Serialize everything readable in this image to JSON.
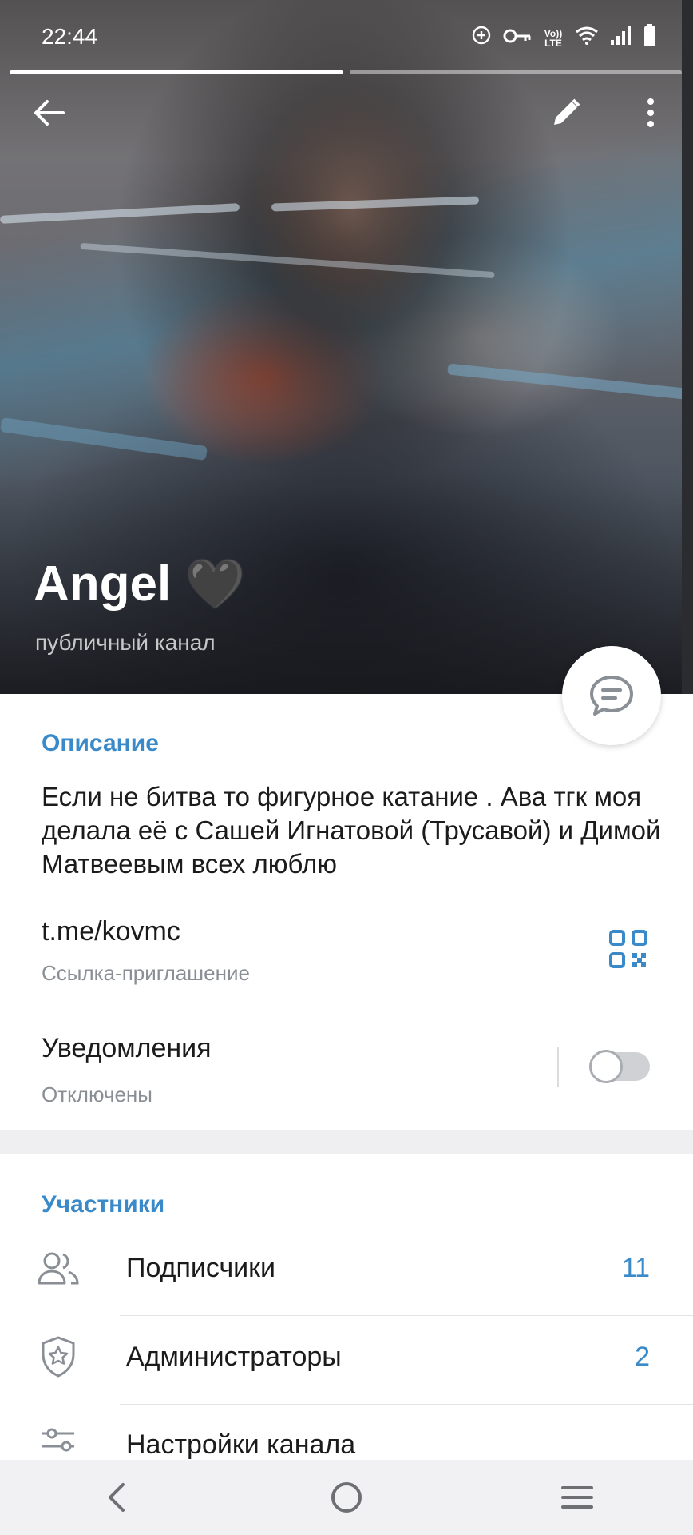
{
  "status_bar": {
    "time": "22:44",
    "icons": [
      "data-saver-icon",
      "vpn-key-icon",
      "volte-icon",
      "wifi-icon",
      "signal-icon",
      "battery-icon"
    ],
    "volte_text": "Vo)) LTE"
  },
  "story_progress": {
    "segments": 2,
    "active": 1
  },
  "header": {
    "title": "Angel",
    "title_emoji": "🖤",
    "subtitle": "публичный канал"
  },
  "description": {
    "label": "Описание",
    "text": "Если не битва то фигурное катание . Ава тгк моя делала её с Сашей Игнатовой (Трусавой) и Димой Матвеевым всех люблю"
  },
  "invite_link": {
    "value": "t.me/kovmc",
    "caption": "Ссылка-приглашение"
  },
  "notifications": {
    "label": "Уведомления",
    "state": "Отключены",
    "enabled": false
  },
  "members": {
    "label": "Участники",
    "rows": [
      {
        "label": "Подписчики",
        "count": "11",
        "icon": "people-icon"
      },
      {
        "label": "Администраторы",
        "count": "2",
        "icon": "admin-shield-icon"
      },
      {
        "label": "Настройки канала",
        "count": "",
        "icon": "settings-sliders-icon"
      }
    ]
  },
  "colors": {
    "accent": "#3a8ac9",
    "secondary_text": "#8a8f95"
  }
}
